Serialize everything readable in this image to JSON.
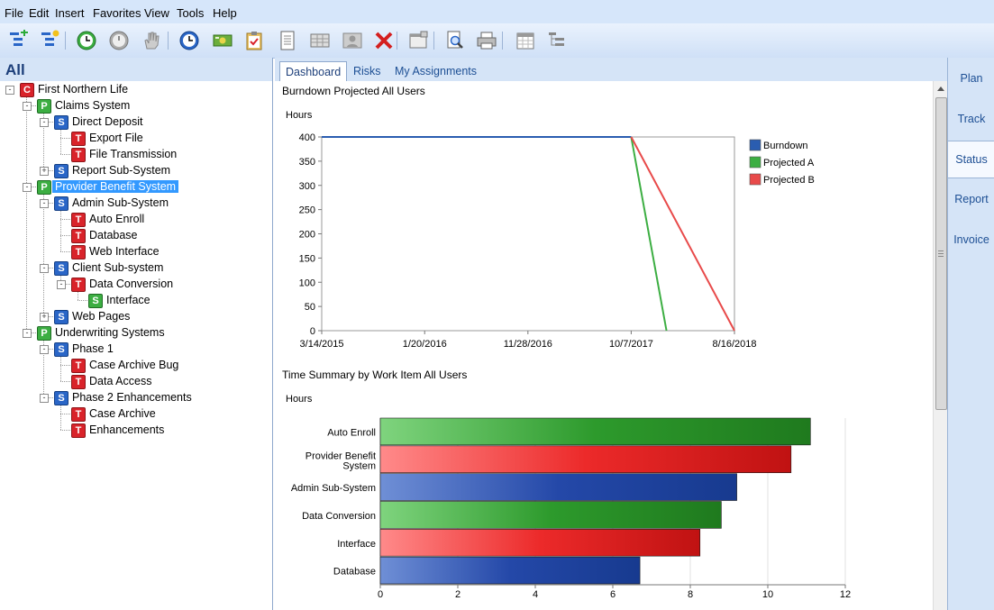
{
  "menu": [
    "File",
    "Edit",
    "Insert",
    "Favorites",
    "View",
    "Tools",
    "Help"
  ],
  "toolbar": {
    "icons": [
      "add-child-icon",
      "add-sibling-icon",
      "clock-green-icon",
      "clock-gray-icon",
      "hand-icon",
      "clock-blue-icon",
      "money-icon",
      "clipboard-icon",
      "document-icon",
      "grid-icon",
      "contact-card-icon",
      "delete-icon",
      "window-icon",
      "print-preview-icon",
      "printer-icon",
      "calendar-icon",
      "hierarchy-icon"
    ]
  },
  "left": {
    "title": "All",
    "tree": [
      {
        "label": "First Northern Life",
        "type": "C",
        "level": 0,
        "expand": "-"
      },
      {
        "label": "Claims System",
        "type": "P",
        "level": 1,
        "expand": "-"
      },
      {
        "label": "Direct Deposit",
        "type": "S",
        "level": 2,
        "expand": "-"
      },
      {
        "label": "Export File",
        "type": "T",
        "level": 3,
        "expand": ""
      },
      {
        "label": "File Transmission",
        "type": "T",
        "level": 3,
        "expand": ""
      },
      {
        "label": "Report Sub-System",
        "type": "S",
        "level": 2,
        "expand": "+"
      },
      {
        "label": "Provider Benefit System",
        "type": "P",
        "level": 1,
        "expand": "-",
        "selected": true
      },
      {
        "label": "Admin Sub-System",
        "type": "S",
        "level": 2,
        "expand": "-"
      },
      {
        "label": "Auto Enroll",
        "type": "T",
        "level": 3,
        "expand": ""
      },
      {
        "label": "Database",
        "type": "T",
        "level": 3,
        "expand": ""
      },
      {
        "label": "Web Interface",
        "type": "T",
        "level": 3,
        "expand": ""
      },
      {
        "label": "Client Sub-system",
        "type": "S",
        "level": 2,
        "expand": "-"
      },
      {
        "label": "Data Conversion",
        "type": "T",
        "level": 3,
        "expand": "-"
      },
      {
        "label": "Interface",
        "type": "S2",
        "level": 4,
        "expand": ""
      },
      {
        "label": "Web Pages",
        "type": "S",
        "level": 2,
        "expand": "+"
      },
      {
        "label": "Underwriting Systems",
        "type": "P",
        "level": 1,
        "expand": "-"
      },
      {
        "label": "Phase 1",
        "type": "S",
        "level": 2,
        "expand": "-"
      },
      {
        "label": "Case Archive Bug",
        "type": "T",
        "level": 3,
        "expand": ""
      },
      {
        "label": "Data Access",
        "type": "T",
        "level": 3,
        "expand": ""
      },
      {
        "label": "Phase 2 Enhancements",
        "type": "S",
        "level": 2,
        "expand": "-"
      },
      {
        "label": "Case Archive",
        "type": "T",
        "level": 3,
        "expand": ""
      },
      {
        "label": "Enhancements",
        "type": "T",
        "level": 3,
        "expand": ""
      }
    ]
  },
  "tabs": [
    {
      "label": "Dashboard",
      "active": true
    },
    {
      "label": "Risks",
      "active": false
    },
    {
      "label": "My Assignments",
      "active": false
    }
  ],
  "right_nav": [
    {
      "label": "Plan",
      "active": false
    },
    {
      "label": "Track",
      "active": false
    },
    {
      "label": "Status",
      "active": true
    },
    {
      "label": "Report",
      "active": false
    },
    {
      "label": "Invoice",
      "active": false
    }
  ],
  "chart_data": [
    {
      "type": "line",
      "title": "Burndown Projected All Users",
      "ylabel": "Hours",
      "xlabel": "",
      "ylim": [
        0,
        400
      ],
      "yticks": [
        0,
        50,
        100,
        150,
        200,
        250,
        300,
        350,
        400
      ],
      "xticks": [
        "3/14/2015",
        "1/20/2016",
        "11/28/2016",
        "10/7/2017",
        "8/16/2018"
      ],
      "x_range": [
        "3/14/2015",
        "8/16/2018"
      ],
      "legend": "right",
      "series": [
        {
          "name": "Burndown",
          "color": "#2a5db0",
          "points": [
            [
              "3/14/2015",
              400
            ],
            [
              "10/7/2017",
              400
            ]
          ]
        },
        {
          "name": "Projected A",
          "color": "#3cae42",
          "points": [
            [
              "10/7/2017",
              400
            ],
            [
              "1/22/2018",
              0
            ]
          ]
        },
        {
          "name": "Projected B",
          "color": "#e84a4a",
          "points": [
            [
              "10/7/2017",
              400
            ],
            [
              "8/16/2018",
              0
            ]
          ]
        }
      ]
    },
    {
      "type": "bar",
      "orientation": "horizontal",
      "title": "Time Summary by Work Item All Users",
      "ylabel": "Hours",
      "xlim": [
        0,
        12
      ],
      "xticks": [
        0,
        2,
        4,
        6,
        8,
        10,
        12
      ],
      "categories": [
        "Auto Enroll",
        "Provider Benefit System",
        "Admin Sub-System",
        "Data Conversion",
        "Interface",
        "Database"
      ],
      "values": [
        11.1,
        10.6,
        9.2,
        8.8,
        8.25,
        6.7
      ],
      "colors": [
        "green",
        "red",
        "blue",
        "green",
        "red",
        "blue"
      ]
    }
  ]
}
